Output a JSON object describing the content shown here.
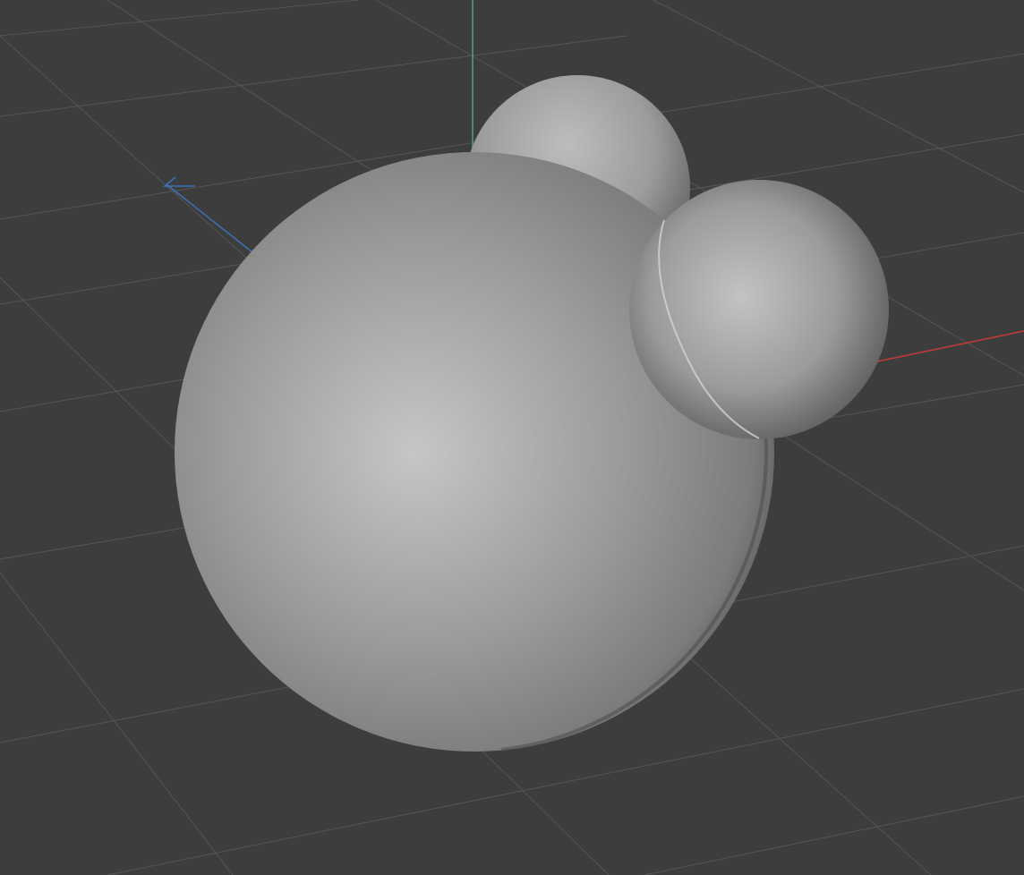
{
  "viewport": {
    "background_color": "#3d3d3d",
    "grid_color": "#555555",
    "grid_visible": true
  },
  "axes": {
    "x_axis_color": "#c83a3a",
    "y_axis_color": "#3fae6e",
    "z_axis_color": "#3a72b8"
  },
  "objects": [
    {
      "name": "large-sphere",
      "shading": "smooth"
    },
    {
      "name": "left-small-sphere",
      "shading": "smooth"
    },
    {
      "name": "right-small-sphere",
      "shading": "smooth"
    }
  ],
  "shading": {
    "highlight_color": "#c9c9c9",
    "mid_color": "#8e8e8e",
    "shadow_color": "#4a4a4a"
  }
}
